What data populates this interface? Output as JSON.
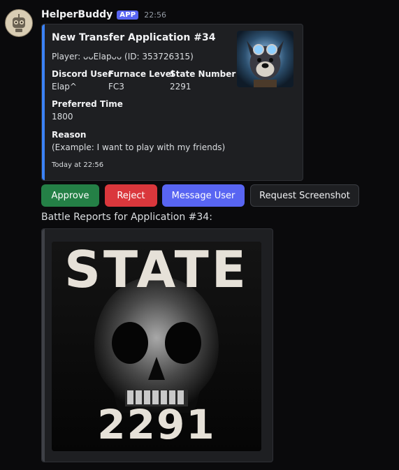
{
  "message": {
    "username": "HelperBuddy",
    "badge": "APP",
    "timestamp": "22:56"
  },
  "embed": {
    "accent_color": "#3b82f6",
    "title": "New Transfer Application #34",
    "player_line": "Player: ᴗᴗElapᴗᴗ (ID: 353726315)",
    "fields": [
      {
        "name": "Discord User",
        "value": "Elap^"
      },
      {
        "name": "Furnace Level",
        "value": "FC3"
      },
      {
        "name": "State Number",
        "value": "2291"
      },
      {
        "name": "Preferred Time",
        "value": "1800"
      },
      {
        "name": "Reason",
        "value": "(Example: I want to play with my friends)"
      }
    ],
    "footer": "Today at 22:56"
  },
  "buttons": {
    "approve": "Approve",
    "reject": "Reject",
    "message_user": "Message User",
    "request_screenshot": "Request Screenshot"
  },
  "colors": {
    "approve": "#248046",
    "reject": "#da373c",
    "blurple": "#5865f2"
  },
  "reports": {
    "text": "Battle Reports for Application #34:",
    "image_title": "STATE",
    "image_number": "2291"
  }
}
